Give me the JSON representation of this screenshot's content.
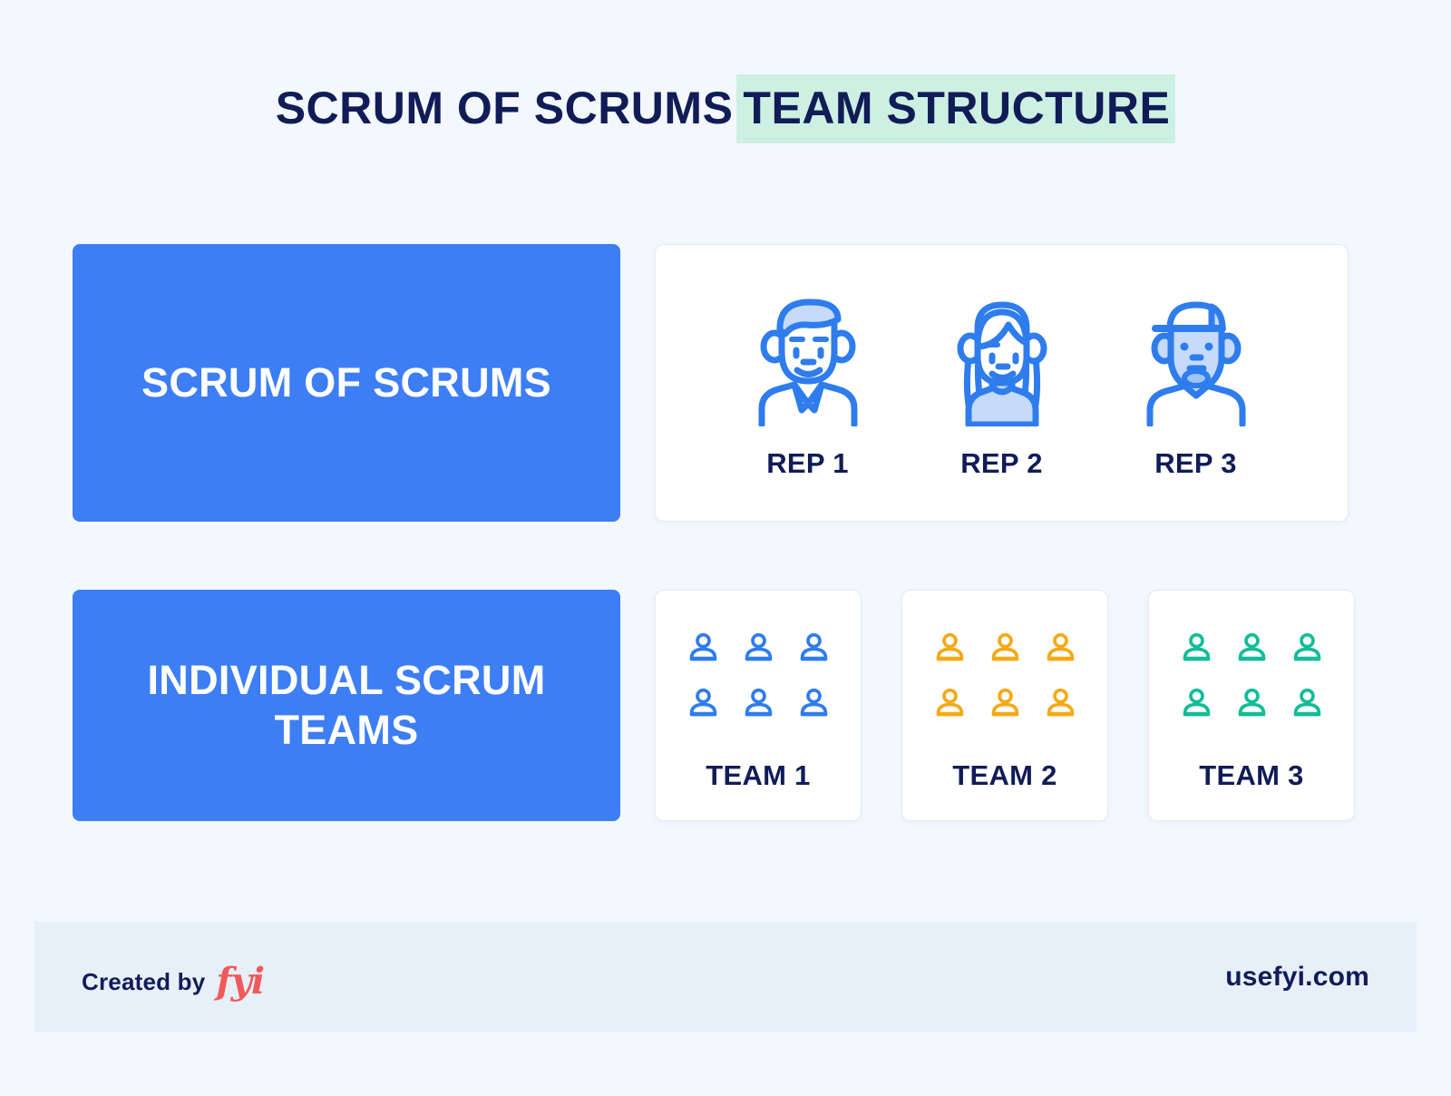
{
  "title": {
    "plain": "SCRUM OF SCRUMS",
    "highlighted": "TEAM STRUCTURE",
    "highlight_color": "#cdf0e3",
    "text_color": "#111c57"
  },
  "rows": {
    "top": {
      "label": "SCRUM OF SCRUMS",
      "label_box_color": "#3d7ef5",
      "reps": [
        {
          "label": "REP 1",
          "icon": "avatar-man-short-hair-icon",
          "color": "#2f7ced"
        },
        {
          "label": "REP 2",
          "icon": "avatar-woman-long-hair-icon",
          "color": "#2f7ced"
        },
        {
          "label": "REP 3",
          "icon": "avatar-man-cap-beard-icon",
          "color": "#2f7ced"
        }
      ]
    },
    "bottom": {
      "label": "INDIVIDUAL SCRUM TEAMS",
      "label_box_color": "#3d7ef5",
      "teams": [
        {
          "label": "TEAM 1",
          "color": "#2f7ced",
          "member_count": 6,
          "icon": "person-icon"
        },
        {
          "label": "TEAM 2",
          "color": "#f5a914",
          "member_count": 6,
          "icon": "person-icon"
        },
        {
          "label": "TEAM 3",
          "color": "#12bd97",
          "member_count": 6,
          "icon": "person-icon"
        }
      ]
    }
  },
  "footer": {
    "credit_text": "Created by",
    "credit_logo": "fyi",
    "credit_logo_color": "#ef5a5a",
    "site_url": "usefyi.com",
    "band_color": "#e7eff9"
  },
  "page": {
    "background_color": "#f2f8fd"
  }
}
